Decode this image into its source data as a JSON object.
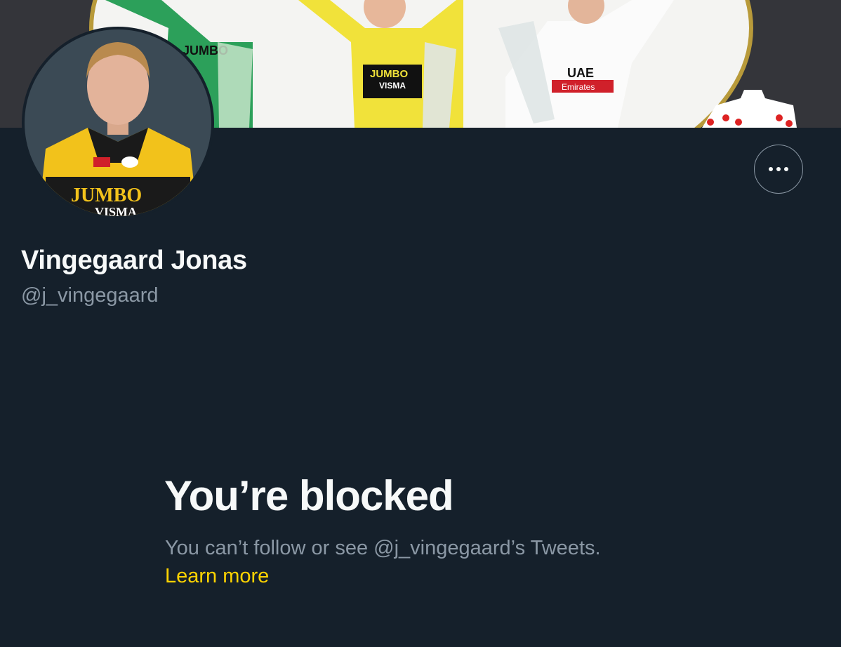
{
  "profile": {
    "display_name": "Vingegaard Jonas",
    "handle": "@j_vingegaard"
  },
  "banner": {
    "sponsor_left": "JUMBO",
    "sponsor_center_top": "JUMBO",
    "sponsor_center_bottom": "VISMA",
    "sponsor_right_top": "UAE",
    "sponsor_right_bottom": "Emirates"
  },
  "avatar": {
    "jersey_top": "JUMBO",
    "jersey_bottom": "VISMA"
  },
  "actions": {
    "more_icon": "more-horizontal-icon"
  },
  "blocked": {
    "title": "You’re blocked",
    "description": "You can’t follow or see @j_vingegaard’s Tweets.",
    "link_label": "Learn more"
  },
  "colors": {
    "background": "#15202b",
    "primary_text": "#f7f9f9",
    "secondary_text": "#8b98a5",
    "accent": "#ffd400"
  }
}
